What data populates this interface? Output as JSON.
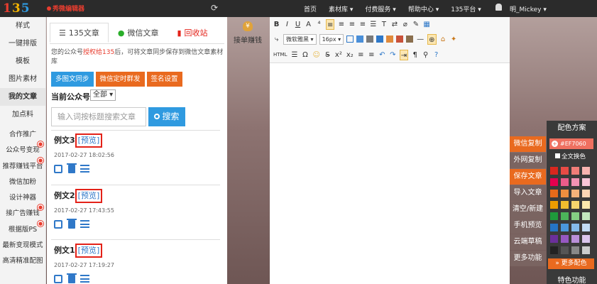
{
  "topbar": {
    "logo_chars": [
      "1",
      "3",
      "5"
    ],
    "slogan": "秀微编辑器",
    "nav": [
      "首页",
      "素材库",
      "付费服务",
      "帮助中心",
      "135平台"
    ],
    "user": "明_Mickey"
  },
  "sidebar": {
    "items": [
      "样式",
      "一键排版",
      "模板",
      "图片素材",
      "我的文章",
      "加点料"
    ],
    "active": "我的文章",
    "sub_items": [
      "合作推广",
      "公众号变现",
      "推荐赚钱平台",
      "微信加粉",
      "设计神器",
      "接广告赚钱",
      "根据版PS",
      "最新变现模式",
      "高清精准配图"
    ]
  },
  "panel": {
    "tabs": [
      "135文章",
      "微信文章",
      "回收站"
    ],
    "notice_prefix": "您的公众号",
    "notice_link": "授权给135",
    "notice_suffix": "后，可将文章同步保存到微信文章素材库",
    "buttons": [
      "多图文同步",
      "微信定时群发",
      "签名设置"
    ],
    "account_label": "当前公众号",
    "account_value": "全部",
    "search_placeholder": "输入词按标题搜索文章",
    "search_button": "搜索",
    "preview_label": "[预览]",
    "articles": [
      {
        "title": "例文3",
        "date": "2017-02-27 18:02:56"
      },
      {
        "title": "例文2",
        "date": "2017-02-27 17:43:55"
      },
      {
        "title": "例文1",
        "date": "2017-02-27 17:19:27"
      }
    ]
  },
  "money": {
    "label": "接单赚钱",
    "icon": "money-bag-icon"
  },
  "toolbar": {
    "font_family": "微软雅黑",
    "font_size": "16px",
    "row1": [
      "B",
      "I",
      "U",
      "A",
      "⁴",
      "≡",
      "≡",
      "≡",
      "≡",
      "☰",
      "T",
      "⇄",
      "⌀",
      "✎",
      "▦"
    ],
    "row3_html": "HTML"
  },
  "actions": [
    "微信复制",
    "外网复制",
    "保存文章",
    "导入文章",
    "清空/新建",
    "手机预览",
    "云端草稿",
    "更多功能"
  ],
  "color_panel": {
    "title": "配色方案",
    "hex": "#EF7060",
    "apply_all": "全文换色",
    "swatches": [
      "#d9271e",
      "#e84b45",
      "#f07d78",
      "#f8b4b0",
      "#e4004f",
      "#ec5c8a",
      "#f392b3",
      "#f9c6d8",
      "#e66a1a",
      "#ef8f3f",
      "#f5b27a",
      "#fbd6b5",
      "#ec9c00",
      "#f2bd2e",
      "#f6d56d",
      "#fbe8ad",
      "#1f9a3b",
      "#4cb55a",
      "#85cf83",
      "#c3e7be",
      "#2574c4",
      "#4a97dc",
      "#84bbea",
      "#c1dcf5",
      "#6b2f9b",
      "#9658c2",
      "#b98fd8",
      "#dbc6ec",
      "#222222",
      "#555555",
      "#888888",
      "#cccccc"
    ],
    "more": "更多配色",
    "features": "特色功能"
  }
}
